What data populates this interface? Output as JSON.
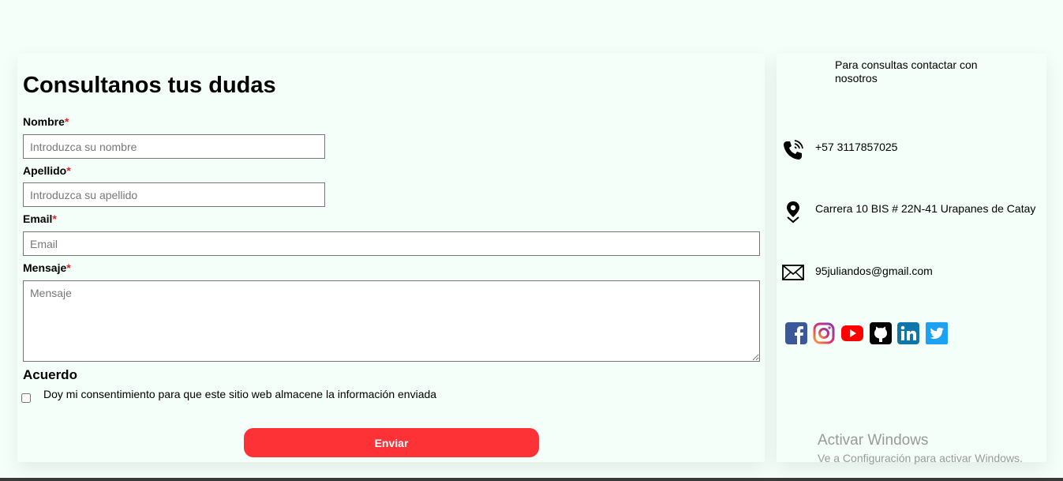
{
  "form": {
    "title": "Consultanos tus dudas",
    "required_mark": "*",
    "fields": {
      "nombre": {
        "label": "Nombre",
        "placeholder": "Introduzca su nombre",
        "value": ""
      },
      "apellido": {
        "label": "Apellido",
        "placeholder": "Introduzca su apellido",
        "value": ""
      },
      "email": {
        "label": "Email",
        "placeholder": "Email",
        "value": ""
      },
      "mensaje": {
        "label": "Mensaje",
        "placeholder": "Mensaje",
        "value": ""
      }
    },
    "agreement": {
      "heading": "Acuerdo",
      "consent_text": "Doy mi consentimiento para que este sitio web almacene la información enviada",
      "checked": false
    },
    "submit_label": "Enviar"
  },
  "contact": {
    "intro": "Para consultas contactar con nosotros",
    "phone": "+57 3117857025",
    "address": "Carrera 10 BIS # 22N-41 Urapanes de Catay",
    "email": "95juliandos@gmail.com",
    "icons": {
      "phone": "phone-icon",
      "address": "location-pin-icon",
      "email": "envelope-icon"
    },
    "social": [
      {
        "name": "facebook-icon",
        "color": "#3b5998"
      },
      {
        "name": "instagram-icon",
        "color": "#c13584"
      },
      {
        "name": "youtube-icon",
        "color": "#ff0000"
      },
      {
        "name": "github-icon",
        "color": "#000000"
      },
      {
        "name": "linkedin-icon",
        "color": "#0e76a8"
      },
      {
        "name": "twitter-icon",
        "color": "#1da1f2"
      }
    ]
  },
  "watermark": {
    "title": "Activar Windows",
    "subtitle": "Ve a Configuración para activar Windows."
  },
  "colors": {
    "background": "#f5fff9",
    "panel": "#f3fff8",
    "accent": "#fd3237",
    "required": "#e0242b"
  }
}
